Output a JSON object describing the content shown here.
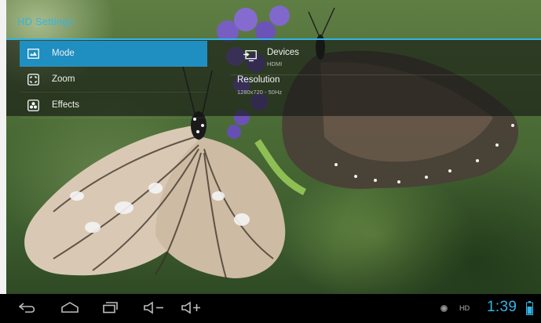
{
  "app": {
    "title": "HD Settings"
  },
  "menu": {
    "items": [
      {
        "label": "Mode",
        "icon": "monitor-wave-icon",
        "selected": true
      },
      {
        "label": "Zoom",
        "icon": "zoom-frame-icon",
        "selected": false
      },
      {
        "label": "Effects",
        "icon": "effects-dots-icon",
        "selected": false
      }
    ]
  },
  "detail": {
    "devices": {
      "title": "Devices",
      "value": "HDMI",
      "icon": "display-output-icon"
    },
    "resolution": {
      "title": "Resolution",
      "value": "1280x720 - 50Hz"
    }
  },
  "navbar": {
    "buttons": [
      "back-icon",
      "home-icon",
      "recent-apps-icon",
      "volume-down-icon",
      "volume-up-icon"
    ]
  },
  "status": {
    "hd_badge": "HD",
    "time": "1:39",
    "icons": [
      "notification-dot-icon",
      "battery-icon"
    ]
  },
  "colors": {
    "accent": "#33b5e5",
    "selected_bg": "#1f8ec1",
    "panel_bg": "rgba(20,22,20,0.62)",
    "navbar_bg": "#000000"
  }
}
